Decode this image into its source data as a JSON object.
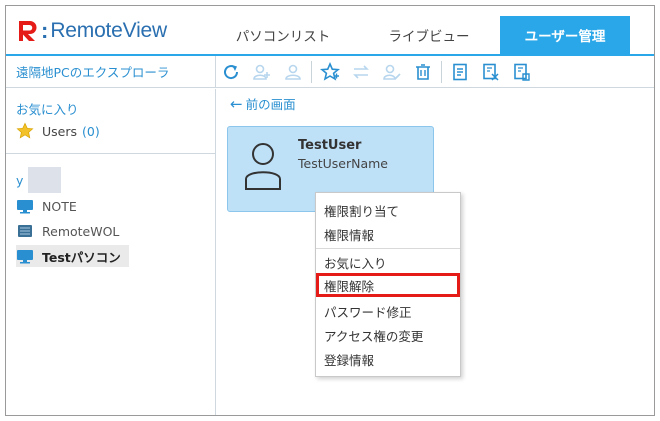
{
  "app": {
    "name": "RemoteView",
    "brand_color": "#e41b17",
    "accent_color": "#2aa7e8",
    "link_color": "#2a8fd0"
  },
  "header": {
    "tabs": [
      {
        "label": "パソコンリスト",
        "active": false
      },
      {
        "label": "ライブビュー",
        "active": false
      },
      {
        "label": "ユーザー管理",
        "active": true
      }
    ]
  },
  "explorer": {
    "title": "遠隔地PCのエクスプローラ"
  },
  "toolbar": {
    "buttons": [
      {
        "icon": "refresh-icon",
        "enabled": true
      },
      {
        "icon": "add-user-icon",
        "enabled": false
      },
      {
        "icon": "user-icon",
        "enabled": false
      },
      {
        "icon": "star-icon",
        "enabled": true
      },
      {
        "icon": "transfer-icon",
        "enabled": false
      },
      {
        "icon": "user-edit-icon",
        "enabled": false
      },
      {
        "icon": "delete-icon",
        "enabled": true
      },
      {
        "icon": "document-icon",
        "enabled": true
      },
      {
        "icon": "export-icon",
        "enabled": true
      },
      {
        "icon": "import-icon",
        "enabled": true
      }
    ]
  },
  "sidebar": {
    "favorites_title": "お気に入り",
    "favorites_item": {
      "label": "Users",
      "count": "(0)"
    },
    "group_label": "y",
    "pcs": [
      {
        "label": "NOTE",
        "selected": false
      },
      {
        "label": "RemoteWOL",
        "selected": false
      },
      {
        "label": "Testパソコン",
        "selected": true
      }
    ]
  },
  "main": {
    "back_label": "前の画面",
    "user_card": {
      "name": "TestUser",
      "full_name": "TestUserName"
    }
  },
  "context_menu": {
    "items": [
      {
        "label": "権限割り当て"
      },
      {
        "label": "権限情報"
      },
      {
        "label": "お気に入り"
      },
      {
        "label": "権限解除",
        "highlighted": true
      },
      {
        "label": "パスワード修正"
      },
      {
        "label": "アクセス権の変更"
      },
      {
        "label": "登録情報"
      }
    ]
  }
}
